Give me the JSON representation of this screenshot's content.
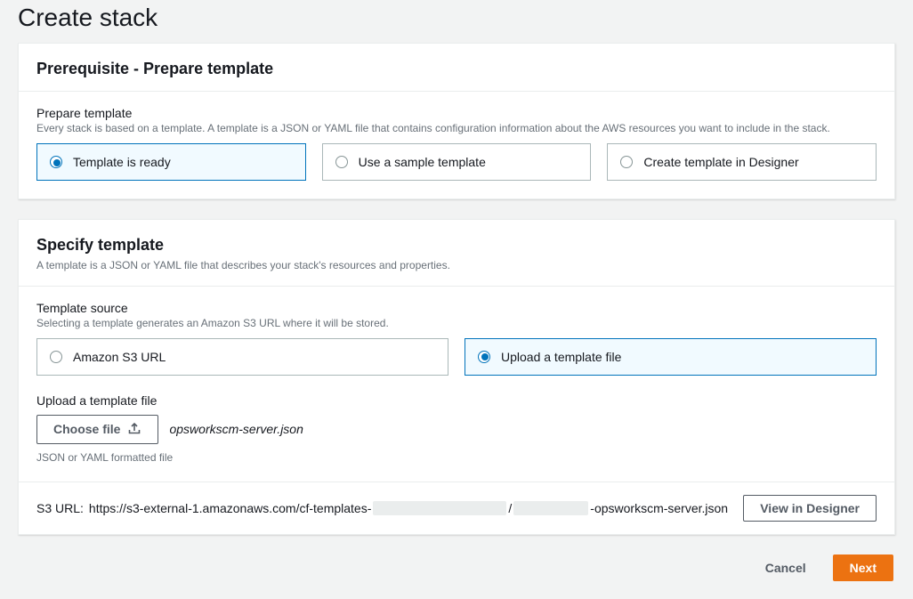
{
  "page": {
    "title": "Create stack"
  },
  "prerequisite": {
    "title": "Prerequisite - Prepare template",
    "field_label": "Prepare template",
    "field_hint": "Every stack is based on a template. A template is a JSON or YAML file that contains configuration information about the AWS resources you want to include in the stack.",
    "options": [
      "Template is ready",
      "Use a sample template",
      "Create template in Designer"
    ],
    "selected_index": 0
  },
  "specify": {
    "title": "Specify template",
    "desc": "A template is a JSON or YAML file that describes your stack's resources and properties.",
    "source_label": "Template source",
    "source_hint": "Selecting a template generates an Amazon S3 URL where it will be stored.",
    "source_options": [
      "Amazon S3 URL",
      "Upload a template file"
    ],
    "source_selected_index": 1,
    "upload": {
      "label": "Upload a template file",
      "choose_button": "Choose file",
      "filename": "opsworkscm-server.json",
      "hint": "JSON or YAML formatted file"
    },
    "s3": {
      "label": "S3 URL:",
      "url_prefix": "https://s3-external-1.amazonaws.com/cf-templates-",
      "separator": "/",
      "url_suffix": "-opsworkscm-server.json",
      "view_button": "View in Designer"
    }
  },
  "footer": {
    "cancel": "Cancel",
    "next": "Next"
  }
}
